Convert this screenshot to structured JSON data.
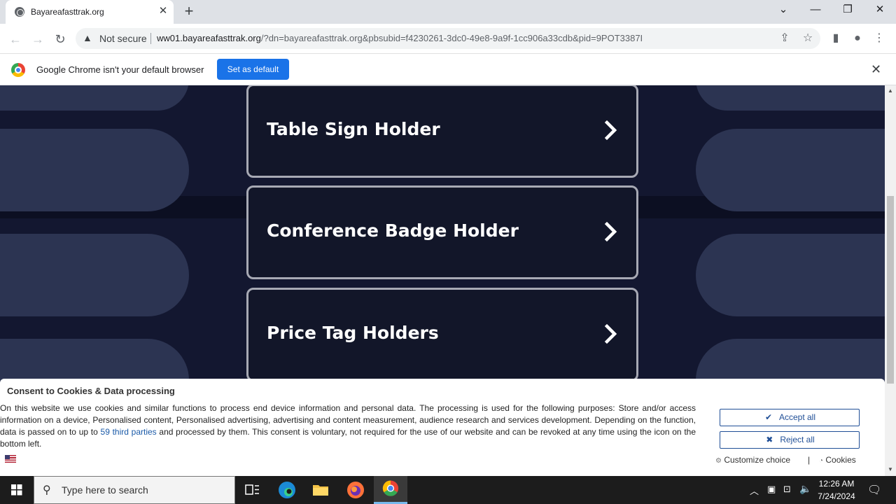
{
  "browser": {
    "tab_title": "Bayareafasttrak.org",
    "tab_close": "✕",
    "new_tab": "+",
    "security_label": "Not secure",
    "url_host": "ww01.bayareafasttrak.org",
    "url_path": "/?dn=bayareafasttrak.org&pbsubid=f4230261-3dc0-49e8-9a9f-1cc906a33cdb&pid=9POT3387I"
  },
  "infobar": {
    "message": "Google Chrome isn't your default browser",
    "button_label": "Set as default"
  },
  "page": {
    "cards": [
      {
        "label": "Table Sign Holder"
      },
      {
        "label": "Conference Badge Holder"
      },
      {
        "label": "Price Tag Holders"
      }
    ]
  },
  "consent": {
    "title": "Consent to Cookies & Data processing",
    "text_before_link": "On this website we use cookies and similar functions to process end device information and personal data. The processing is used for the following purposes: Store and/or access information on a device, Personalised content, Personalised advertising, advertising and content measurement, audience research and services development. Depending on the function, data is passed on to up to ",
    "link_text": "59 third parties",
    "text_after_link": " and processed by them. This consent is voluntary, not required for the use of our website and can be revoked at any time using the icon on the bottom left.",
    "accept_label": "Accept all",
    "reject_label": "Reject all",
    "customize_label": "Customize choice",
    "separator": "|",
    "cookies_label": "Cookies"
  },
  "taskbar": {
    "search_placeholder": "Type here to search",
    "time": "12:26 AM",
    "date": "7/24/2024"
  },
  "colors": {
    "page_background": "#131730",
    "card_border": "#a7a9b4",
    "pill": "#2c3452",
    "accent_blue": "#1a73e8",
    "consent_button": "#1f4e96"
  }
}
